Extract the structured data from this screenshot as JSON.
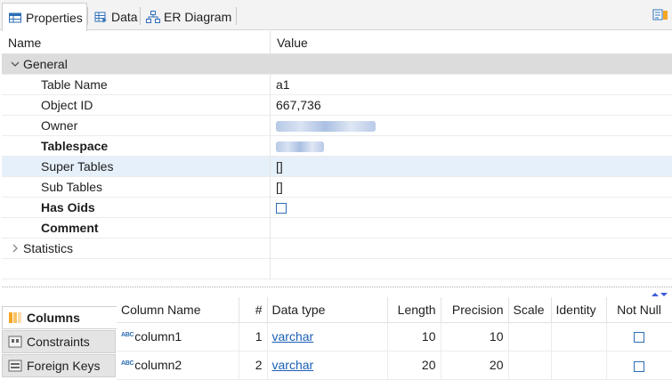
{
  "tabs": [
    {
      "label": "Properties",
      "icon": "properties-table-icon",
      "active": true
    },
    {
      "label": "Data",
      "icon": "data-grid-icon",
      "active": false
    },
    {
      "label": "ER Diagram",
      "icon": "er-diagram-icon",
      "active": false
    }
  ],
  "property_grid": {
    "header": {
      "name": "Name",
      "value": "Value"
    },
    "groups": [
      {
        "label": "General",
        "expanded": true,
        "rows": [
          {
            "name": "Table Name",
            "value": "a1",
            "bold": false
          },
          {
            "name": "Object ID",
            "value": "667,736",
            "bold": false
          },
          {
            "name": "Owner",
            "value": "",
            "bold": false,
            "blurred": true
          },
          {
            "name": "Tablespace",
            "value": "",
            "bold": true,
            "blurred": true
          },
          {
            "name": "Super Tables",
            "value": "[]",
            "bold": false,
            "selected": true
          },
          {
            "name": "Sub Tables",
            "value": "[]",
            "bold": false
          },
          {
            "name": "Has Oids",
            "value": "",
            "bold": true,
            "checkbox": true
          },
          {
            "name": "Comment",
            "value": "",
            "bold": true
          }
        ]
      },
      {
        "label": "Statistics",
        "expanded": false
      }
    ]
  },
  "side_tabs": [
    {
      "label": "Columns",
      "active": true
    },
    {
      "label": "Constraints",
      "active": false
    },
    {
      "label": "Foreign Keys",
      "active": false
    }
  ],
  "columns_table": {
    "headers": [
      "Column Name",
      "#",
      "Data type",
      "Length",
      "Precision",
      "Scale",
      "Identity",
      "Not Null"
    ],
    "rows": [
      {
        "name": "column1",
        "index": "1",
        "type": "varchar",
        "length": "10",
        "precision": "10",
        "scale": "",
        "identity": "",
        "not_null": false
      },
      {
        "name": "column2",
        "index": "2",
        "type": "varchar",
        "length": "20",
        "precision": "20",
        "scale": "",
        "identity": "",
        "not_null": false
      }
    ],
    "type_icon_text": "ABC"
  },
  "colors": {
    "accent": "#2d6db5",
    "link": "#1a5fb4",
    "group_bg": "#dcdcdc",
    "selected_bg": "#e6f0fa",
    "columns_icon": "#f5a623"
  }
}
